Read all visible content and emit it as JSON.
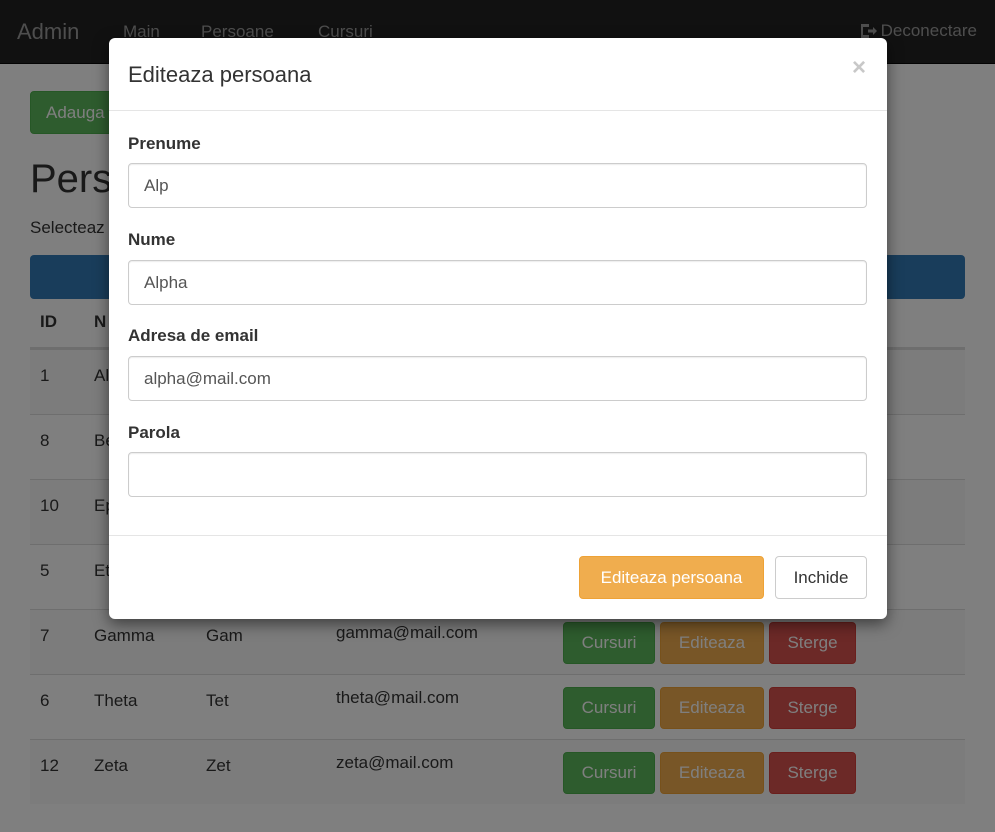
{
  "navbar": {
    "brand": "Admin",
    "links": [
      "Main",
      "Persoane",
      "Cursuri"
    ],
    "logout": "Deconectare"
  },
  "page": {
    "add_button": "Adauga",
    "title": "Pers",
    "subtitle": "Selecteaz"
  },
  "table": {
    "headers": {
      "id": "ID",
      "col2": "N"
    },
    "rows": [
      {
        "id": "1",
        "c1": "Al",
        "c2": "",
        "c3": ""
      },
      {
        "id": "8",
        "c1": "Be",
        "c2": "",
        "c3": ""
      },
      {
        "id": "10",
        "c1": "Ep",
        "c2": "",
        "c3": ""
      },
      {
        "id": "5",
        "c1": "Et",
        "c2": "",
        "c3": ""
      },
      {
        "id": "7",
        "c1": "Gamma",
        "c2": "Gam",
        "c3": "gamma@mail.com"
      },
      {
        "id": "6",
        "c1": "Theta",
        "c2": "Tet",
        "c3": "theta@mail.com"
      },
      {
        "id": "12",
        "c1": "Zeta",
        "c2": "Zet",
        "c3": "zeta@mail.com"
      }
    ],
    "actions": {
      "courses": "Cursuri",
      "edit": "Editeaza",
      "delete": "Sterge"
    }
  },
  "modal": {
    "title": "Editeaza persoana",
    "close_symbol": "×",
    "fields": {
      "first_name": {
        "label": "Prenume",
        "value": "Alp"
      },
      "last_name": {
        "label": "Nume",
        "value": "Alpha"
      },
      "email": {
        "label": "Adresa de email",
        "value": "alpha@mail.com"
      },
      "password": {
        "label": "Parola",
        "value": ""
      }
    },
    "submit_button": "Editeaza persoana",
    "close_button": "Inchide"
  },
  "colors": {
    "success": "#5cb85c",
    "warning": "#f0ad4e",
    "danger": "#d9534f",
    "primary": "#337ab7",
    "navbar": "#222222"
  },
  "icons": {
    "logout": "logout-icon",
    "close": "close-icon"
  }
}
